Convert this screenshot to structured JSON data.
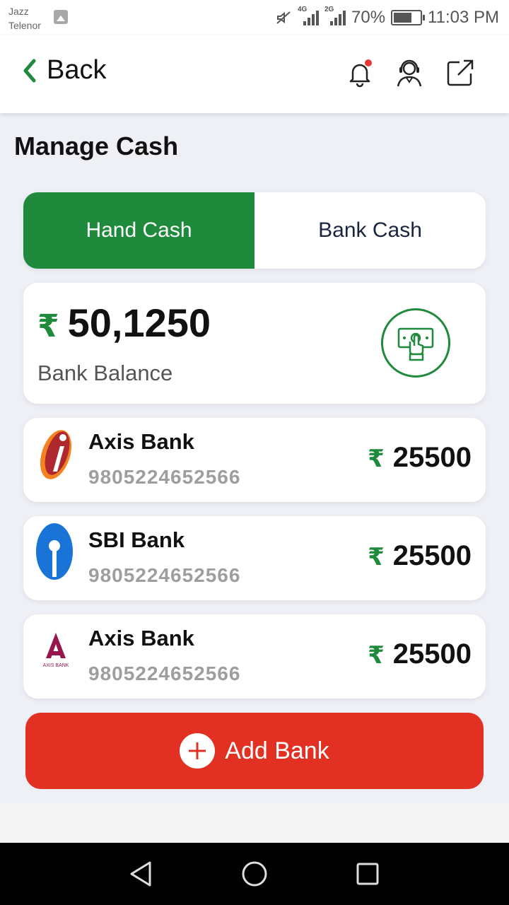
{
  "status_bar": {
    "carrier_line1": "Jazz",
    "carrier_line2": "Telenor",
    "sim1_network": "4G",
    "sim2_network": "2G",
    "battery_percent": "70%",
    "battery_level": 0.7,
    "time": "11:03 PM",
    "icons": [
      "gallery-icon",
      "mute-icon",
      "signal-icon",
      "battery-icon"
    ]
  },
  "header": {
    "back_label": "Back",
    "icons": [
      "chevron-left-icon",
      "bell-icon",
      "support-agent-icon",
      "external-link-icon"
    ]
  },
  "page": {
    "title": "Manage Cash"
  },
  "tabs": [
    {
      "label": "Hand Cash",
      "active": true
    },
    {
      "label": "Bank Cash",
      "active": false
    }
  ],
  "balance": {
    "currency": "₹",
    "amount": "50,1250",
    "label": "Bank Balance",
    "icon": "cash-hand-icon"
  },
  "banks": [
    {
      "name": "Axis Bank",
      "account": "9805224652566",
      "currency": "₹",
      "amount": "25500",
      "logo": "icici-logo"
    },
    {
      "name": "SBI Bank",
      "account": "9805224652566",
      "currency": "₹",
      "amount": "25500",
      "logo": "sbi-logo"
    },
    {
      "name": "Axis Bank",
      "account": "9805224652566",
      "currency": "₹",
      "amount": "25500",
      "logo": "axis-logo",
      "logo_text": "AXIS BANK"
    }
  ],
  "add_bank": {
    "label": "Add Bank",
    "icon": "plus-icon"
  },
  "nav": {
    "icons": [
      "back-triangle-icon",
      "home-circle-icon",
      "recents-square-icon"
    ]
  },
  "colors": {
    "primary_green": "#1f8a3c",
    "danger_red": "#e23122",
    "background": "#eef0f6"
  }
}
